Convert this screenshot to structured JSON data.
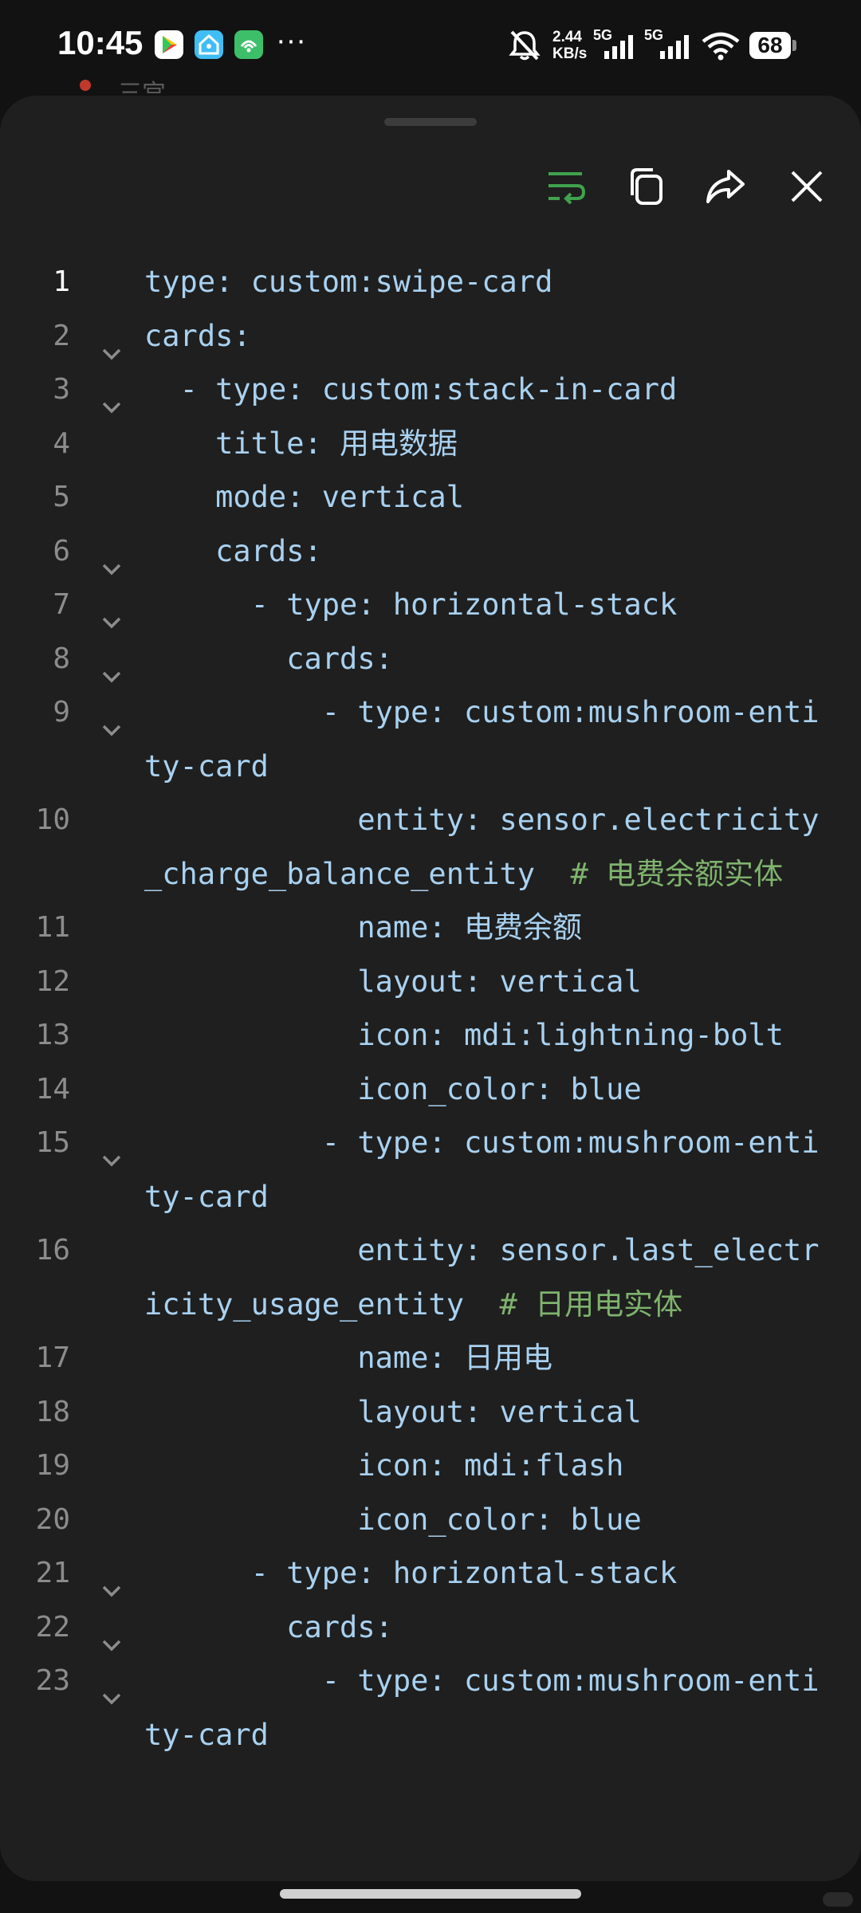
{
  "status_bar": {
    "time": "10:45",
    "more": "···",
    "net_speed_value": "2.44",
    "net_speed_unit": "KB/s",
    "sim1_label": "5G",
    "sim2_label": "5G",
    "battery": "68",
    "icons": [
      "google-play-icon",
      "home-assistant-icon",
      "app-icon",
      "mute-icon",
      "signal-icon",
      "wifi-icon",
      "battery-icon"
    ]
  },
  "behind_text": "三宫",
  "toolbar": {
    "wrap": "wrap-lines-icon",
    "copy": "copy-icon",
    "share": "share-icon",
    "close": "close-icon",
    "wrap_color": "#3fa34d"
  },
  "code": {
    "active_line": 1,
    "lines": [
      {
        "n": "1",
        "fold": false,
        "text": "type: custom:swipe-card",
        "comment": ""
      },
      {
        "n": "2",
        "fold": true,
        "text": "cards:",
        "comment": ""
      },
      {
        "n": "3",
        "fold": true,
        "text": "  - type: custom:stack-in-card",
        "comment": ""
      },
      {
        "n": "4",
        "fold": false,
        "text": "    title: 用电数据",
        "comment": ""
      },
      {
        "n": "5",
        "fold": false,
        "text": "    mode: vertical",
        "comment": ""
      },
      {
        "n": "6",
        "fold": true,
        "text": "    cards:",
        "comment": ""
      },
      {
        "n": "7",
        "fold": true,
        "text": "      - type: horizontal-stack",
        "comment": ""
      },
      {
        "n": "8",
        "fold": true,
        "text": "        cards:",
        "comment": ""
      },
      {
        "n": "9",
        "fold": true,
        "text": "          - type: custom:mushroom-entity-card",
        "comment": ""
      },
      {
        "n": "10",
        "fold": false,
        "text": "            entity: sensor.electricity_charge_balance_entity  ",
        "comment": "# 电费余额实体"
      },
      {
        "n": "11",
        "fold": false,
        "text": "            name: 电费余额",
        "comment": ""
      },
      {
        "n": "12",
        "fold": false,
        "text": "            layout: vertical",
        "comment": ""
      },
      {
        "n": "13",
        "fold": false,
        "text": "            icon: mdi:lightning-bolt",
        "comment": ""
      },
      {
        "n": "14",
        "fold": false,
        "text": "            icon_color: blue",
        "comment": ""
      },
      {
        "n": "15",
        "fold": true,
        "text": "          - type: custom:mushroom-entity-card",
        "comment": ""
      },
      {
        "n": "16",
        "fold": false,
        "text": "            entity: sensor.last_electricity_usage_entity  ",
        "comment": "# 日用电实体"
      },
      {
        "n": "17",
        "fold": false,
        "text": "            name: 日用电",
        "comment": ""
      },
      {
        "n": "18",
        "fold": false,
        "text": "            layout: vertical",
        "comment": ""
      },
      {
        "n": "19",
        "fold": false,
        "text": "            icon: mdi:flash",
        "comment": ""
      },
      {
        "n": "20",
        "fold": false,
        "text": "            icon_color: blue",
        "comment": ""
      },
      {
        "n": "21",
        "fold": true,
        "text": "      - type: horizontal-stack",
        "comment": ""
      },
      {
        "n": "22",
        "fold": true,
        "text": "        cards:",
        "comment": ""
      },
      {
        "n": "23",
        "fold": true,
        "text": "          - type: custom:mushroom-entity-card",
        "comment": ""
      }
    ]
  },
  "colors": {
    "code_text": "#a9d1f0",
    "comment": "#7fb36e",
    "line_number": "#8c8c8c",
    "sheet_bg": "#1f1f1f"
  }
}
